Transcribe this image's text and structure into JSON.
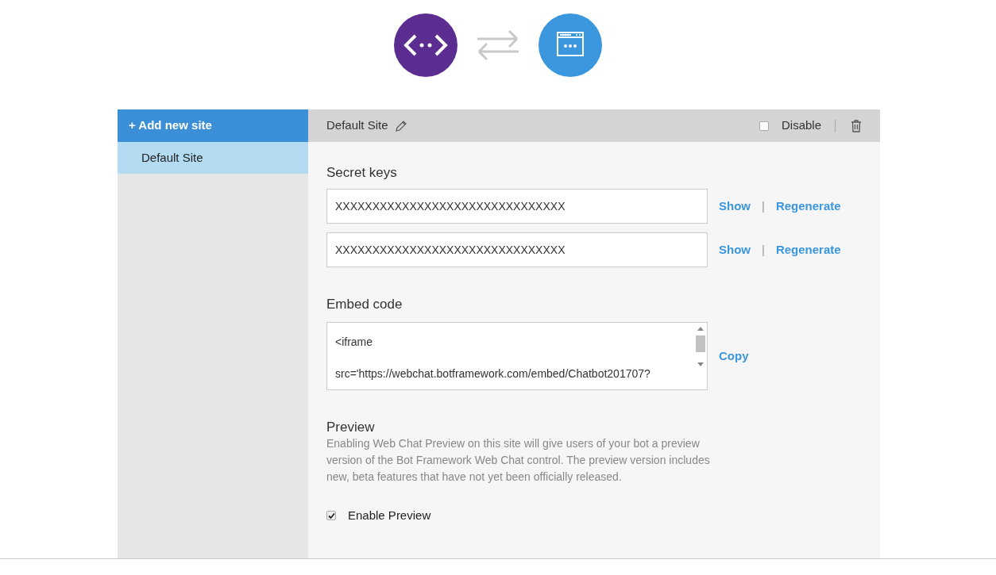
{
  "sidebar": {
    "add_button": "+ Add new site",
    "items": [
      {
        "label": "Default Site",
        "selected": true
      }
    ]
  },
  "site_header": {
    "title": "Default Site",
    "disable_label": "Disable",
    "disabled": false
  },
  "secret_keys": {
    "title": "Secret keys",
    "keys": [
      {
        "value": "XXXXXXXXXXXXXXXXXXXXXXXXXXXXXXX",
        "show": "Show",
        "separator": "|",
        "regenerate": "Regenerate"
      },
      {
        "value": "XXXXXXXXXXXXXXXXXXXXXXXXXXXXXXX",
        "show": "Show",
        "separator": "|",
        "regenerate": "Regenerate"
      }
    ]
  },
  "embed_code": {
    "title": "Embed code",
    "value": "<iframe\n\nsrc='https://webchat.botframework.com/embed/Chatbot201707?",
    "copy": "Copy"
  },
  "preview": {
    "title": "Preview",
    "description": "Enabling Web Chat Preview on this site will give users of your bot a preview version of the Bot Framework Web Chat control. The preview version includes new, beta features that have not yet been officially released.",
    "checkbox_label": "Enable Preview",
    "checked": true
  }
}
